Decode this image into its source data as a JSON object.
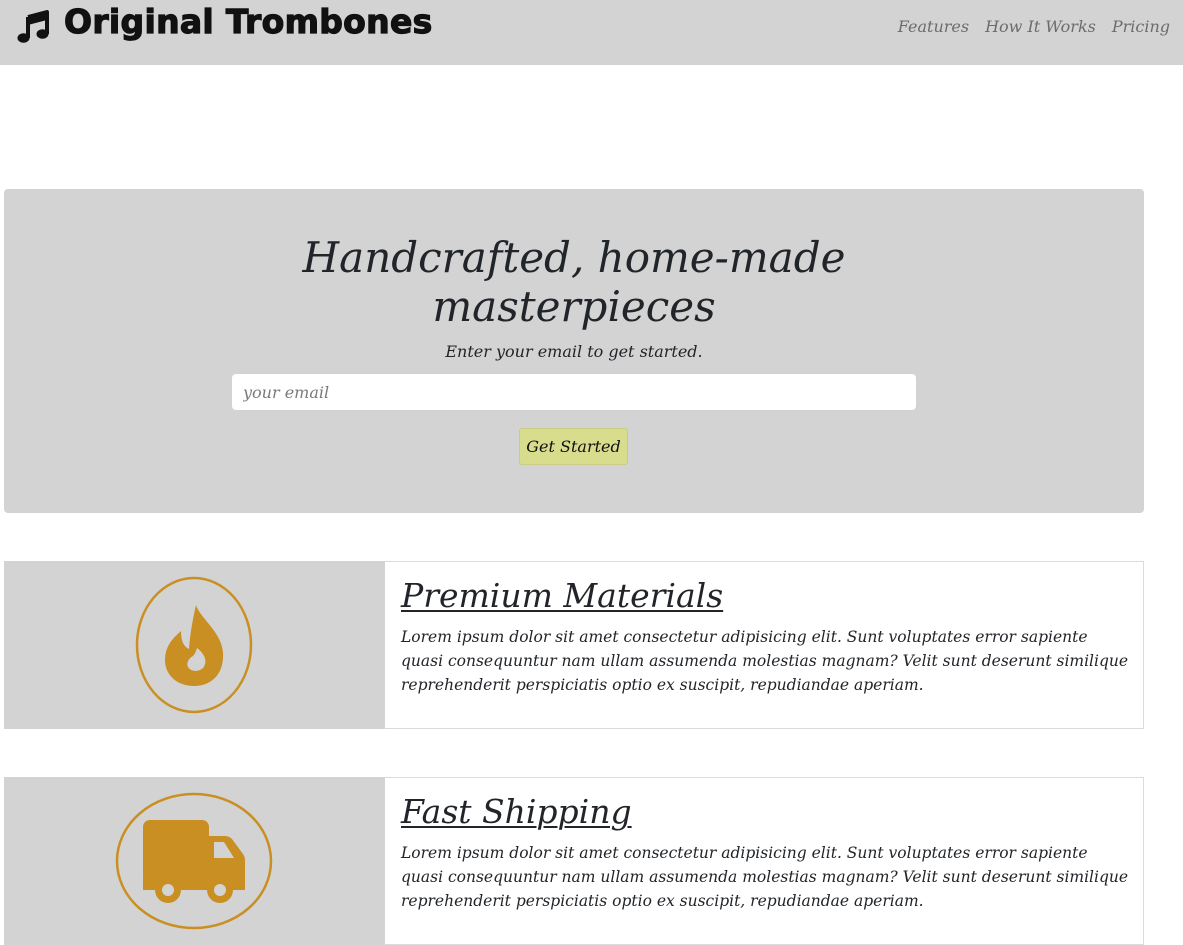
{
  "header": {
    "brand": "Original Trombones",
    "logo_icon": "music-note-icon",
    "nav": [
      {
        "label": "Features"
      },
      {
        "label": "How It Works"
      },
      {
        "label": "Pricing"
      }
    ]
  },
  "hero": {
    "title": "Handcrafted, home-made masterpieces",
    "subtitle": "Enter your email to get started.",
    "email_placeholder": "your email",
    "email_value": "",
    "cta_label": "Get Started"
  },
  "features": [
    {
      "icon": "flame-icon",
      "title": "Premium Materials",
      "text": "Lorem ipsum dolor sit amet consectetur adipisicing elit. Sunt voluptates error sapiente quasi consequuntur nam ullam assumenda molestias magnam? Velit sunt deserunt similique reprehenderit perspiciatis optio ex suscipit, repudiandae aperiam."
    },
    {
      "icon": "truck-icon",
      "title": "Fast Shipping",
      "text": "Lorem ipsum dolor sit amet consectetur adipisicing elit. Sunt voluptates error sapiente quasi consequuntur nam ullam assumenda molestias magnam? Velit sunt deserunt similique reprehenderit perspiciatis optio ex suscipit, repudiandae aperiam."
    }
  ],
  "colors": {
    "header_bg": "#d3d3d3",
    "hero_bg": "#d3d3d3",
    "accent": "#c98f22",
    "cta_bg": "#d8dc8d"
  }
}
